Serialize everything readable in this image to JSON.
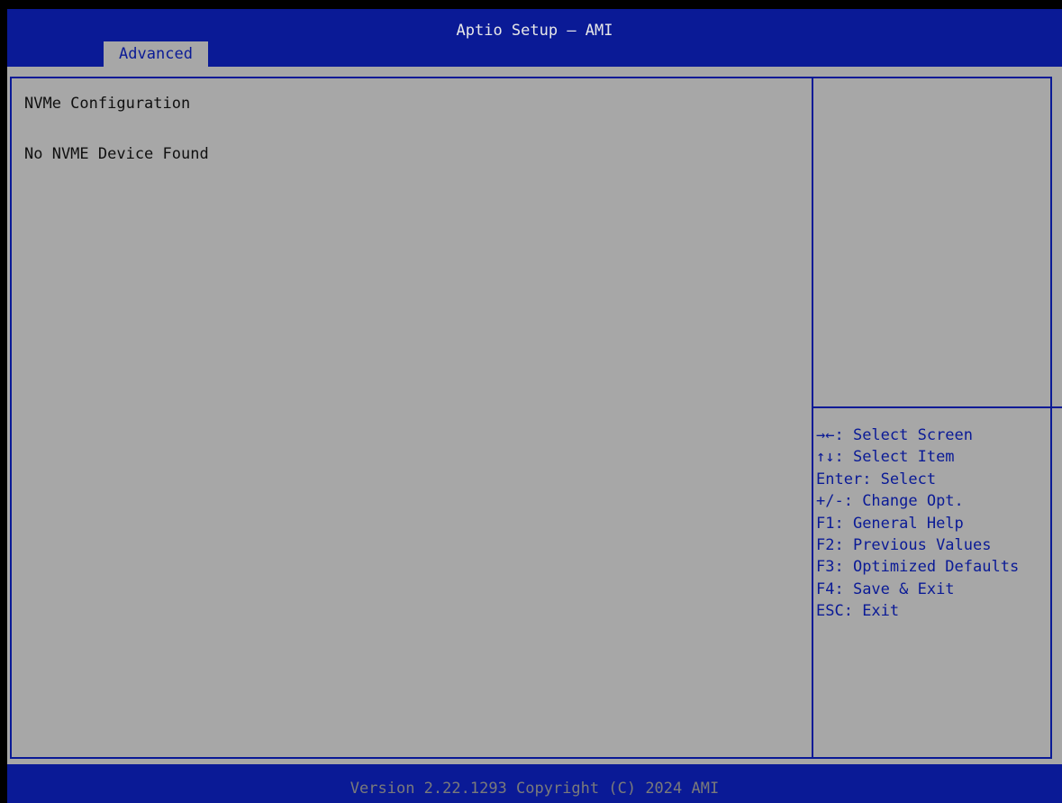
{
  "header": {
    "title": "Aptio Setup – AMI",
    "tabs": [
      {
        "label": "Advanced",
        "selected": true
      }
    ]
  },
  "main": {
    "heading": "NVMe Configuration",
    "message": "No NVME Device Found"
  },
  "help": {
    "items": [
      {
        "key": "→←",
        "text": ": Select Screen",
        "key_icon": "left-right-arrows-icon"
      },
      {
        "key": "↑↓",
        "text": ": Select Item",
        "key_icon": "up-down-arrows-icon"
      },
      {
        "key": "Enter",
        "text": ": Select"
      },
      {
        "key": "+/-",
        "text": ": Change Opt."
      },
      {
        "key": "F1",
        "text": ": General Help"
      },
      {
        "key": "F2",
        "text": ": Previous Values"
      },
      {
        "key": "F3",
        "text": ": Optimized Defaults"
      },
      {
        "key": "F4",
        "text": ": Save & Exit"
      },
      {
        "key": "ESC",
        "text": ": Exit"
      }
    ]
  },
  "footer": {
    "text": "Version 2.22.1293 Copyright (C) 2024 AMI"
  },
  "colors": {
    "header_blue": "#0a1a96",
    "panel_gray": "#a7a7a7",
    "text_dark": "#101010",
    "help_text": "#0a1a96",
    "footer_text": "#7a7a7a"
  }
}
